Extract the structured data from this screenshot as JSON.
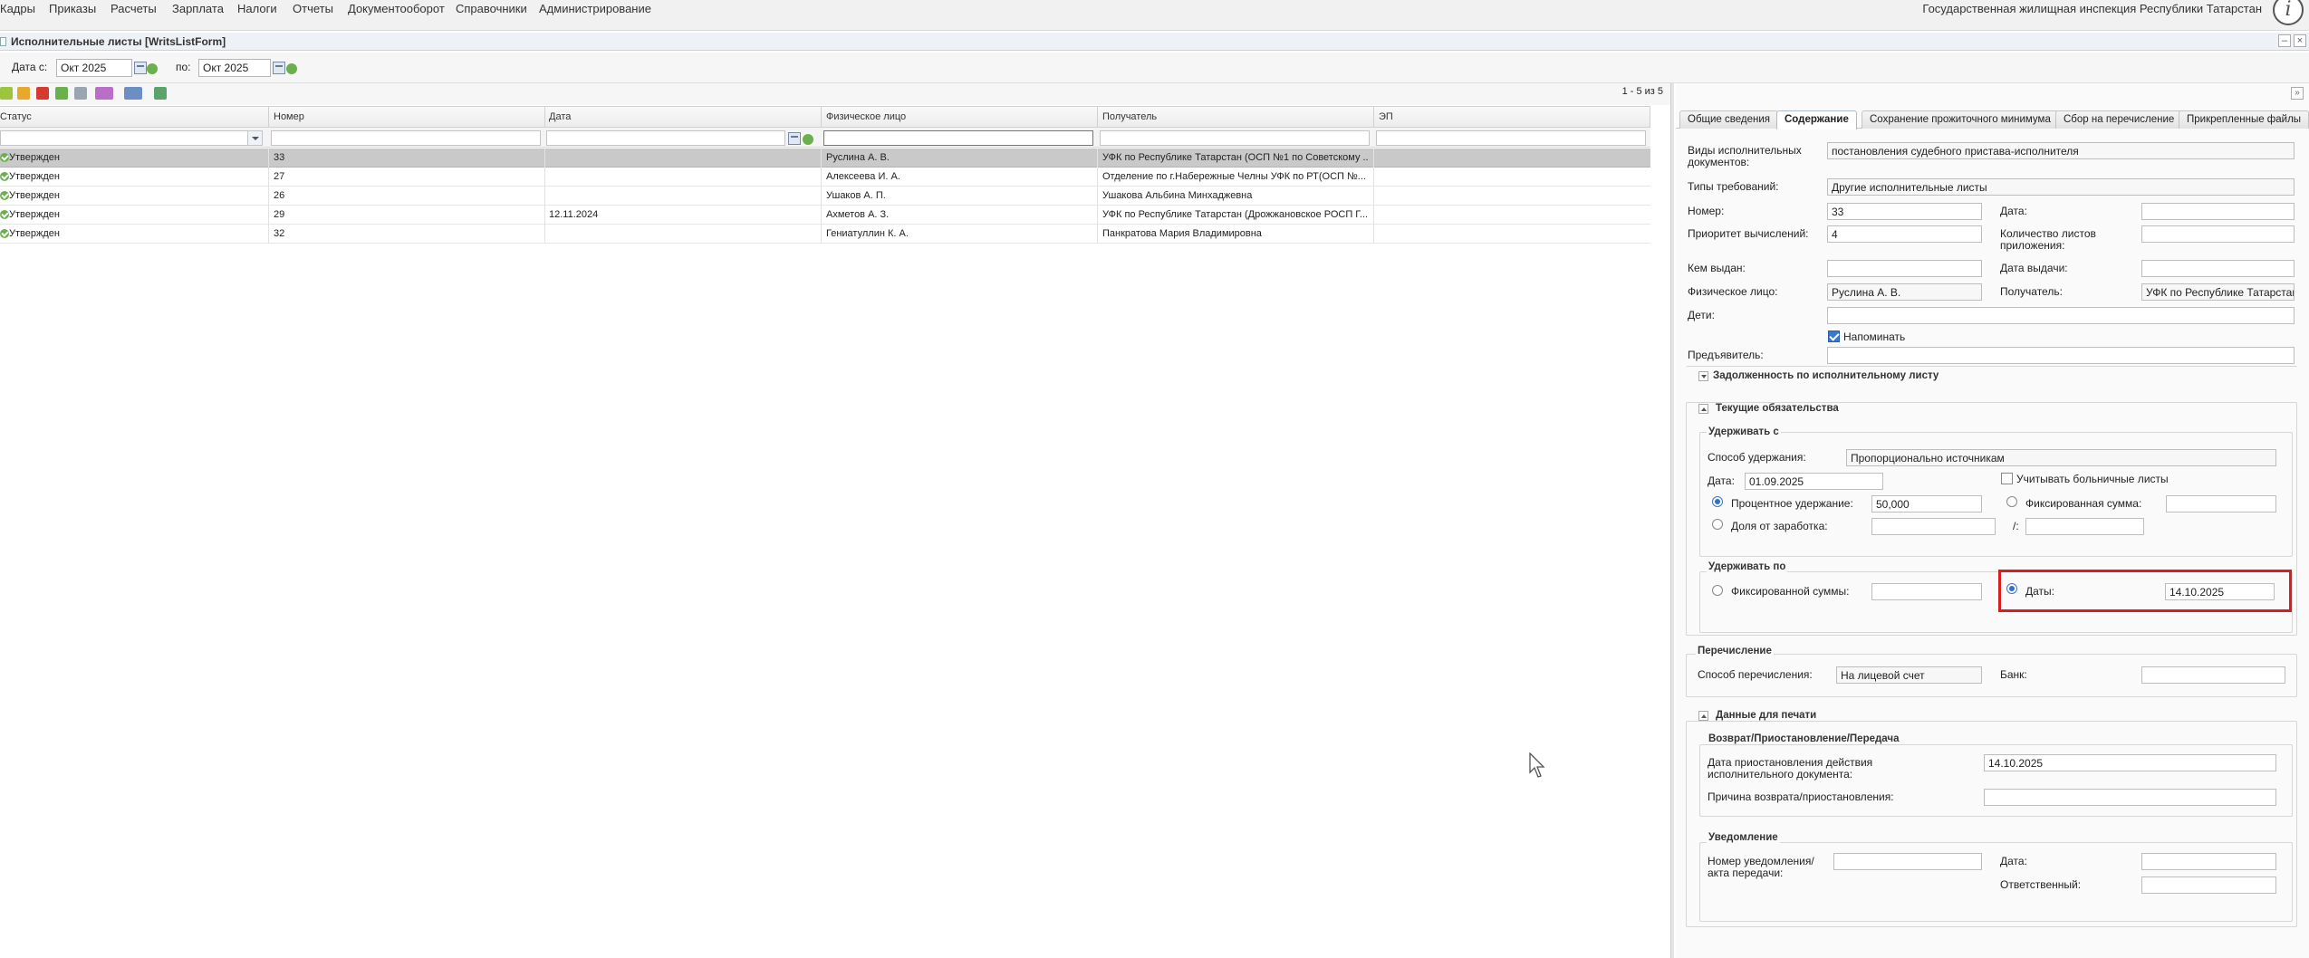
{
  "menu": {
    "items": [
      "Кадры",
      "Приказы",
      "Расчеты",
      "Зарплата",
      "Налоги",
      "Отчеты",
      "Документооборот",
      "Справочники",
      "Администрирование"
    ],
    "organization": "Государственная жилищная инспекция Республики Татарстан",
    "info_label": "i"
  },
  "form": {
    "title": "Исполнительные листы [WritsListForm]"
  },
  "date_filter": {
    "from_label": "Дата с:",
    "from_value": "Окт 2025",
    "to_label": "по:",
    "to_value": "Окт 2025"
  },
  "toolbar": {
    "pager": "1 - 5 из 5",
    "icons": [
      "add-icon",
      "edit-icon",
      "delete-icon",
      "approve-icon",
      "mail-icon",
      "print-icon",
      "list-icon",
      "refresh-icon"
    ]
  },
  "grid": {
    "columns": [
      "Статус",
      "Номер",
      "Дата",
      "Физическое лицо",
      "Получатель",
      "ЭП"
    ],
    "rows": [
      {
        "status": "Утвержден",
        "number": "33",
        "date": "",
        "person": "Руслина А. В.",
        "recipient": "УФК по Республике Татарстан (ОСП №1 по Советскому ...",
        "ep": ""
      },
      {
        "status": "Утвержден",
        "number": "27",
        "date": "",
        "person": "Алексеева И. А.",
        "recipient": "Отделение по г.Набережные Челны УФК по РТ(ОСП №...",
        "ep": ""
      },
      {
        "status": "Утвержден",
        "number": "26",
        "date": "",
        "person": "Ушаков А. П.",
        "recipient": "Ушакова Альбина Минхаджевна",
        "ep": ""
      },
      {
        "status": "Утвержден",
        "number": "29",
        "date": "12.11.2024",
        "person": "Ахметов А. З.",
        "recipient": "УФК по Республике Татарстан (Дрожжановское РОСП Г...",
        "ep": ""
      },
      {
        "status": "Утвержден",
        "number": "32",
        "date": "",
        "person": "Гениатуллин К. А.",
        "recipient": "Панкратова Мария Владимировна",
        "ep": ""
      }
    ]
  },
  "tabs": [
    "Общие сведения",
    "Содержание",
    "Сохранение прожиточного минимума",
    "Сбор на перечисление",
    "Прикрепленные файлы"
  ],
  "active_tab": "Содержание",
  "details": {
    "doc_types_label": "Виды исполнительных документов:",
    "doc_types_value": "постановления судебного пристава-исполнителя",
    "req_types_label": "Типы требований:",
    "req_types_value": "Другие исполнительные листы",
    "number_label": "Номер:",
    "number_value": "33",
    "date_label": "Дата:",
    "date_value": "",
    "priority_label": "Приоритет вычислений:",
    "priority_value": "4",
    "sheets_label": "Количество листов приложения:",
    "sheets_value": "",
    "issued_by_label": "Кем выдан:",
    "issued_by_value": "",
    "issue_date_label": "Дата выдачи:",
    "issue_date_value": "",
    "person_label": "Физическое лицо:",
    "person_value": "Руслина А. В.",
    "recipient_label": "Получатель:",
    "recipient_value": "УФК по Республике Татарстан",
    "children_label": "Дети:",
    "children_value": "",
    "remind_label": "Напоминать",
    "presenter_label": "Предъявитель:",
    "presenter_value": ""
  },
  "debt_section": {
    "title": "Задолженность по исполнительному листу"
  },
  "obligations": {
    "title": "Текущие обязательства",
    "withhold_from_title": "Удерживать с",
    "method_label": "Способ удержания:",
    "method_value": "Пропорционально источникам",
    "date_label": "Дата:",
    "date_value": "01.09.2025",
    "sick_leave_label": "Учитывать больничные листы",
    "percent_label": "Процентное удержание:",
    "percent_value": "50,000",
    "fixed_label": "Фиксированная сумма:",
    "fixed_value": "",
    "share_label": "Доля от заработка:",
    "share_value": "",
    "share_sep": "/:",
    "share_denominator": "",
    "withhold_until_title": "Удерживать по",
    "fixed_sum_label": "Фиксированной суммы:",
    "fixed_sum_value": "",
    "dates_label": "Даты:",
    "dates_value": "14.10.2025"
  },
  "transfer": {
    "title": "Перечисление",
    "method_label": "Способ перечисления:",
    "method_value": "На лицевой счет",
    "bank_label": "Банк:",
    "bank_value": ""
  },
  "print_data": {
    "title": "Данные для печати",
    "return_title": "Возврат/Приостановление/Передача",
    "suspend_date_label": "Дата приостановления действия исполнительного документа:",
    "suspend_date_value": "14.10.2025",
    "reason_label": "Причина возврата/приостановления:",
    "reason_value": "",
    "notice_title": "Уведомление",
    "notice_number_label": "Номер уведомления/ акта передачи:",
    "notice_number_value": "",
    "notice_date_label": "Дата:",
    "notice_date_value": "",
    "responsible_label": "Ответственный:",
    "responsible_value": ""
  }
}
